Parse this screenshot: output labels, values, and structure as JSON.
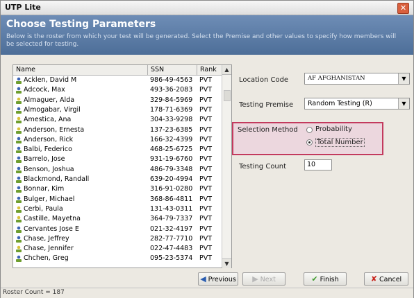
{
  "window": {
    "title": "UTP Lite",
    "close_glyph": "✕"
  },
  "header": {
    "title": "Choose Testing Parameters",
    "description": "Below is the roster from which your test will be generated. Select the Premise and other values to specify how members will be selected for testing."
  },
  "table": {
    "columns": [
      "Name",
      "SSN",
      "Rank"
    ],
    "rows": [
      {
        "name": "Acklen, David M",
        "ssn": "986-49-4563",
        "rank": "PVT",
        "icon": "person-icon-blue"
      },
      {
        "name": "Adcock, Max",
        "ssn": "493-36-2083",
        "rank": "PVT",
        "icon": "person-icon-blue"
      },
      {
        "name": "Almaguer, Alda",
        "ssn": "329-84-5969",
        "rank": "PVT",
        "icon": "person-icon-yellow"
      },
      {
        "name": "Almogabar, Virgil",
        "ssn": "178-71-6369",
        "rank": "PVT",
        "icon": "person-icon-blue"
      },
      {
        "name": "Amestica, Ana",
        "ssn": "304-33-9298",
        "rank": "PVT",
        "icon": "person-icon-yellow"
      },
      {
        "name": "Anderson, Ernesta",
        "ssn": "137-23-6385",
        "rank": "PVT",
        "icon": "person-icon-yellow"
      },
      {
        "name": "Anderson, Rick",
        "ssn": "166-32-4399",
        "rank": "PVT",
        "icon": "person-icon-blue"
      },
      {
        "name": "Balbi, Federico",
        "ssn": "468-25-6725",
        "rank": "PVT",
        "icon": "person-icon-blue"
      },
      {
        "name": "Barrelo, Jose",
        "ssn": "931-19-6760",
        "rank": "PVT",
        "icon": "person-icon-blue"
      },
      {
        "name": "Benson, Joshua",
        "ssn": "486-79-3348",
        "rank": "PVT",
        "icon": "person-icon-blue"
      },
      {
        "name": "Blackmond, Randall",
        "ssn": "639-20-4994",
        "rank": "PVT",
        "icon": "person-icon-blue"
      },
      {
        "name": "Bonnar, Kim",
        "ssn": "316-91-0280",
        "rank": "PVT",
        "icon": "person-icon-blue"
      },
      {
        "name": "Bulger, Michael",
        "ssn": "368-86-4811",
        "rank": "PVT",
        "icon": "person-icon-blue"
      },
      {
        "name": "Cerbi, Paula",
        "ssn": "131-43-0311",
        "rank": "PVT",
        "icon": "person-icon-yellow"
      },
      {
        "name": "Castille, Mayetna",
        "ssn": "364-79-7337",
        "rank": "PVT",
        "icon": "person-icon-yellow"
      },
      {
        "name": "Cervantes Jose E",
        "ssn": "021-32-4197",
        "rank": "PVT",
        "icon": "person-icon-blue"
      },
      {
        "name": "Chase, Jeffrey",
        "ssn": "282-77-7710",
        "rank": "PVT",
        "icon": "person-icon-blue"
      },
      {
        "name": "Chase, Jennifer",
        "ssn": "022-47-4483",
        "rank": "PVT",
        "icon": "person-icon-yellow"
      },
      {
        "name": "Chchen, Greg",
        "ssn": "095-23-5374",
        "rank": "PVT",
        "icon": "person-icon-blue"
      }
    ]
  },
  "form": {
    "location_label": "Location Code",
    "location_value": "AF AFGHANISTAN",
    "premise_label": "Testing Premise",
    "premise_value": "Random Testing (R)",
    "selection_label": "Selection Method",
    "option_probability": "Probability",
    "option_total": "Total Number",
    "selected_option": "Total Number",
    "count_label": "Testing Count",
    "count_value": "10"
  },
  "buttons": {
    "previous": "Previous",
    "next": "Next",
    "finish": "Finish",
    "cancel": "Cancel"
  },
  "status": {
    "text": "Roster Count = 187"
  },
  "colors": {
    "header_blue": "#5a7aa5",
    "highlight": "#c33a5e",
    "finish_green": "#3c9a2a",
    "cancel_red": "#c8261e"
  }
}
